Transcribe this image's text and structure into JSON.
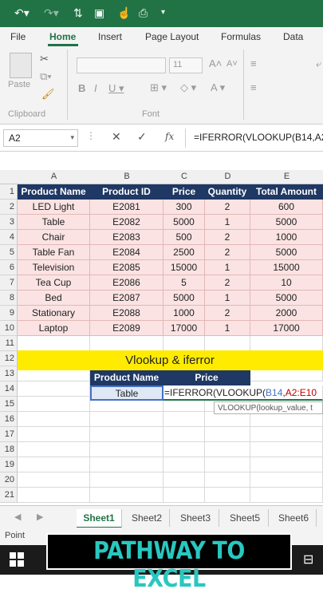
{
  "quick_access": {
    "undo_icon": "undo-icon",
    "redo_icon": "redo-icon",
    "save_icon": "save-icon"
  },
  "tabs": [
    "File",
    "Home",
    "Insert",
    "Page Layout",
    "Formulas",
    "Data"
  ],
  "active_tab": "Home",
  "ribbon": {
    "paste_label": "Paste",
    "clipboard_label": "Clipboard",
    "font_label": "Font",
    "font_size": "11"
  },
  "formula_bar": {
    "name_box": "A2",
    "fx": "fx",
    "formula": "=IFERROR(VLOOKUP(B14,A2"
  },
  "columns": [
    "A",
    "B",
    "C",
    "D",
    "E"
  ],
  "rows": [
    "1",
    "2",
    "3",
    "4",
    "5",
    "6",
    "7",
    "8",
    "9",
    "10",
    "11",
    "12",
    "13",
    "14",
    "15",
    "16",
    "17",
    "18",
    "19",
    "20",
    "21"
  ],
  "table": {
    "headers": [
      "Product Name",
      "Product ID",
      "Price",
      "Quantity",
      "Total Amount"
    ],
    "rows": [
      [
        "LED Light",
        "E2081",
        "300",
        "2",
        "600"
      ],
      [
        "Table",
        "E2082",
        "5000",
        "1",
        "5000"
      ],
      [
        "Chair",
        "E2083",
        "500",
        "2",
        "1000"
      ],
      [
        "Table Fan",
        "E2084",
        "2500",
        "2",
        "5000"
      ],
      [
        "Television",
        "E2085",
        "15000",
        "1",
        "15000"
      ],
      [
        "Tea  Cup",
        "E2086",
        "5",
        "2",
        "10"
      ],
      [
        "Bed",
        "E2087",
        "5000",
        "1",
        "5000"
      ],
      [
        "Stationary",
        "E2088",
        "1000",
        "2",
        "2000"
      ],
      [
        "Laptop",
        "E2089",
        "17000",
        "1",
        "17000"
      ]
    ]
  },
  "lookup": {
    "title": "Vlookup & iferror",
    "hdr_name": "Product Name",
    "hdr_price": "Price",
    "input_value": "Table",
    "formula_prefix": "=IFERROR(VLOOKUP(",
    "formula_ref1": "B14",
    "formula_sep": ",",
    "formula_ref2": "A2:E10",
    "tooltip": "VLOOKUP(lookup_value, t"
  },
  "sheets": [
    "Sheet1",
    "Sheet2",
    "Sheet3",
    "Sheet5",
    "Sheet6"
  ],
  "active_sheet": "Sheet1",
  "status": "Point",
  "banner": "PATHWAY TO EXCEL",
  "colors": {
    "excel_green": "#217346",
    "header_navy": "#1f3864",
    "row_pink": "#fbe3e3",
    "title_yellow": "#ffeb00",
    "banner_text": "#28c8c0"
  }
}
